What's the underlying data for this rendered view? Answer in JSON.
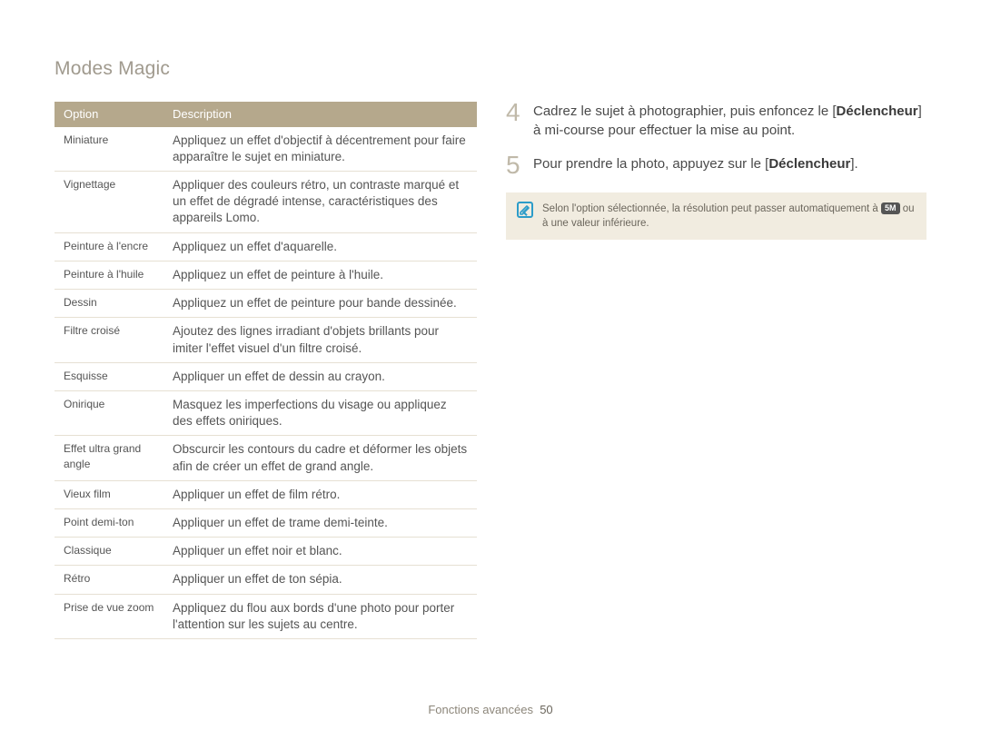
{
  "page_title": "Modes Magic",
  "table": {
    "headers": {
      "option": "Option",
      "description": "Description"
    },
    "rows": [
      {
        "option": "Miniature",
        "description": "Appliquez un effet d'objectif à décentrement pour faire apparaître le sujet en miniature."
      },
      {
        "option": "Vignettage",
        "description": "Appliquer des couleurs rétro, un contraste marqué et un effet de dégradé intense, caractéristiques des appareils Lomo."
      },
      {
        "option": "Peinture à l'encre",
        "description": "Appliquez un effet d'aquarelle."
      },
      {
        "option": "Peinture à l'huile",
        "description": "Appliquez un effet de peinture à l'huile."
      },
      {
        "option": "Dessin",
        "description": "Appliquez un effet de peinture pour bande dessinée."
      },
      {
        "option": "Filtre croisé",
        "description": "Ajoutez des lignes irradiant d'objets brillants pour imiter l'effet visuel d'un filtre croisé."
      },
      {
        "option": "Esquisse",
        "description": "Appliquer un effet de dessin au crayon."
      },
      {
        "option": "Onirique",
        "description": "Masquez les imperfections du visage ou appliquez des effets oniriques."
      },
      {
        "option": "Effet ultra grand angle",
        "description": "Obscurcir les contours du cadre et déformer les objets afin de créer un effet de grand angle."
      },
      {
        "option": "Vieux film",
        "description": "Appliquer un effet de film rétro."
      },
      {
        "option": "Point demi-ton",
        "description": "Appliquer un effet de trame demi-teinte."
      },
      {
        "option": "Classique",
        "description": "Appliquer un effet noir et blanc."
      },
      {
        "option": "Rétro",
        "description": "Appliquer un effet de ton sépia."
      },
      {
        "option": "Prise de vue zoom",
        "description": "Appliquez du flou aux bords d'une photo pour porter l'attention sur les sujets au centre."
      }
    ]
  },
  "steps": {
    "step4": {
      "num": "4",
      "pre": "Cadrez le sujet à photographier, puis enfoncez le [",
      "bold": "Déclencheur",
      "post": "] à mi-course pour effectuer la mise au point."
    },
    "step5": {
      "num": "5",
      "pre": "Pour prendre la photo, appuyez sur le [",
      "bold": "Déclencheur",
      "post": "]."
    }
  },
  "note": {
    "pre": "Selon l'option sélectionnée, la résolution peut passer automatiquement à ",
    "badge": "5M",
    "post": " ou à une valeur inférieure."
  },
  "footer": {
    "section": "Fonctions avancées",
    "page_num": "50"
  }
}
